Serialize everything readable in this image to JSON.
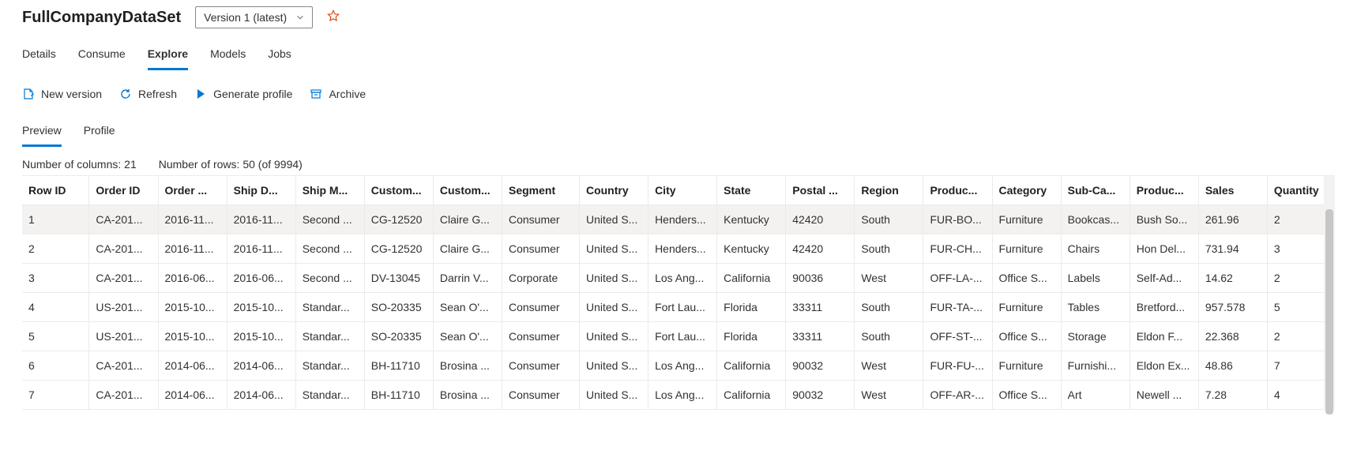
{
  "header": {
    "title": "FullCompanyDataSet",
    "version_label": "Version 1 (latest)"
  },
  "tabs": {
    "items": [
      {
        "label": "Details"
      },
      {
        "label": "Consume"
      },
      {
        "label": "Explore"
      },
      {
        "label": "Models"
      },
      {
        "label": "Jobs"
      }
    ],
    "active_index": 2
  },
  "toolbar": {
    "new_version": "New version",
    "refresh": "Refresh",
    "generate_profile": "Generate profile",
    "archive": "Archive"
  },
  "subtabs": {
    "items": [
      {
        "label": "Preview"
      },
      {
        "label": "Profile"
      }
    ],
    "active_index": 0
  },
  "stats": {
    "columns_text": "Number of columns: 21",
    "rows_text": "Number of rows: 50 (of 9994)"
  },
  "table": {
    "columns": [
      "Row ID",
      "Order ID",
      "Order ...",
      "Ship D...",
      "Ship M...",
      "Custom...",
      "Custom...",
      "Segment",
      "Country",
      "City",
      "State",
      "Postal ...",
      "Region",
      "Produc...",
      "Category",
      "Sub-Ca...",
      "Produc...",
      "Sales",
      "Quantity"
    ],
    "rows": [
      [
        "1",
        "CA-201...",
        "2016-11...",
        "2016-11...",
        "Second ...",
        "CG-12520",
        "Claire G...",
        "Consumer",
        "United S...",
        "Henders...",
        "Kentucky",
        "42420",
        "South",
        "FUR-BO...",
        "Furniture",
        "Bookcas...",
        "Bush So...",
        "261.96",
        "2"
      ],
      [
        "2",
        "CA-201...",
        "2016-11...",
        "2016-11...",
        "Second ...",
        "CG-12520",
        "Claire G...",
        "Consumer",
        "United S...",
        "Henders...",
        "Kentucky",
        "42420",
        "South",
        "FUR-CH...",
        "Furniture",
        "Chairs",
        "Hon Del...",
        "731.94",
        "3"
      ],
      [
        "3",
        "CA-201...",
        "2016-06...",
        "2016-06...",
        "Second ...",
        "DV-13045",
        "Darrin V...",
        "Corporate",
        "United S...",
        "Los Ang...",
        "California",
        "90036",
        "West",
        "OFF-LA-...",
        "Office S...",
        "Labels",
        "Self-Ad...",
        "14.62",
        "2"
      ],
      [
        "4",
        "US-201...",
        "2015-10...",
        "2015-10...",
        "Standar...",
        "SO-20335",
        "Sean O'...",
        "Consumer",
        "United S...",
        "Fort Lau...",
        "Florida",
        "33311",
        "South",
        "FUR-TA-...",
        "Furniture",
        "Tables",
        "Bretford...",
        "957.578",
        "5"
      ],
      [
        "5",
        "US-201...",
        "2015-10...",
        "2015-10...",
        "Standar...",
        "SO-20335",
        "Sean O'...",
        "Consumer",
        "United S...",
        "Fort Lau...",
        "Florida",
        "33311",
        "South",
        "OFF-ST-...",
        "Office S...",
        "Storage",
        "Eldon F...",
        "22.368",
        "2"
      ],
      [
        "6",
        "CA-201...",
        "2014-06...",
        "2014-06...",
        "Standar...",
        "BH-11710",
        "Brosina ...",
        "Consumer",
        "United S...",
        "Los Ang...",
        "California",
        "90032",
        "West",
        "FUR-FU-...",
        "Furniture",
        "Furnishi...",
        "Eldon Ex...",
        "48.86",
        "7"
      ],
      [
        "7",
        "CA-201...",
        "2014-06...",
        "2014-06...",
        "Standar...",
        "BH-11710",
        "Brosina ...",
        "Consumer",
        "United S...",
        "Los Ang...",
        "California",
        "90032",
        "West",
        "OFF-AR-...",
        "Office S...",
        "Art",
        "Newell ...",
        "7.28",
        "4"
      ]
    ]
  }
}
